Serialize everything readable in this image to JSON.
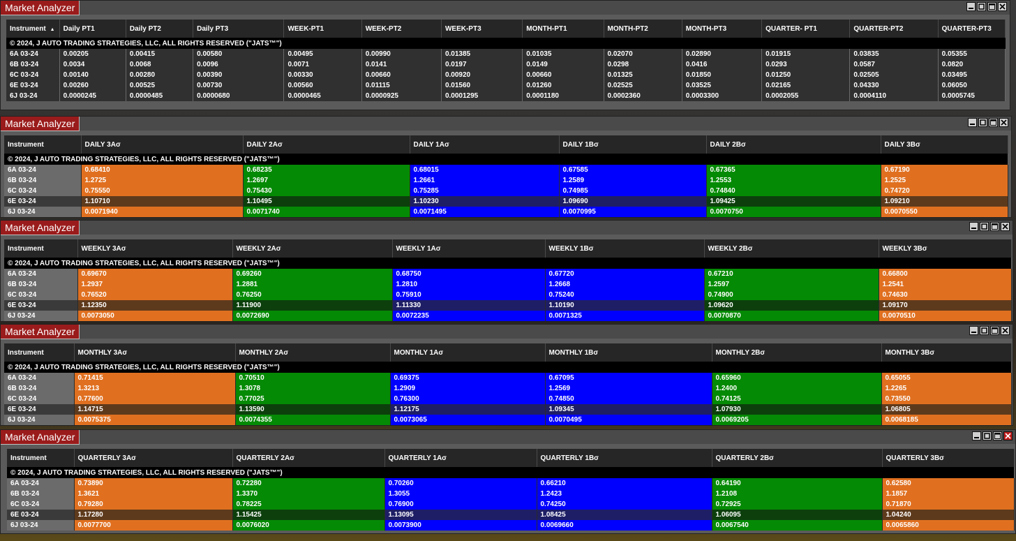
{
  "window_title": "Market Analyzer",
  "copyright": "© 2024, J AUTO TRADING STRATEGIES, LLC, ALL RIGHTS RESERVED (\"JATS™\")",
  "instrument_header": "Instrument",
  "sort_indicator": "▲",
  "colors": {
    "orange": "#e07020",
    "green": "#058a05",
    "blue": "#0000ff",
    "title_red": "#9a1b1b"
  },
  "icons": [
    "minimize-icon",
    "restore-icon",
    "maximize-icon",
    "close-icon"
  ],
  "instruments": [
    "6A 03-24",
    "6B 03-24",
    "6C 03-24",
    "6E 03-24",
    "6J 03-24"
  ],
  "targets": {
    "headers": [
      "Daily PT1",
      "Daily PT2",
      "Daily PT3",
      "WEEK-PT1",
      "WEEK-PT2",
      "WEEK-PT3",
      "MONTH-PT1",
      "MONTH-PT2",
      "MONTH-PT3",
      "QUARTER- PT1",
      "QUARTER-PT2",
      "QUARTER-PT3"
    ],
    "rows": [
      [
        "0.00205",
        "0.00415",
        "0.00580",
        "0.00495",
        "0.00990",
        "0.01385",
        "0.01035",
        "0.02070",
        "0.02890",
        "0.01915",
        "0.03835",
        "0.05355"
      ],
      [
        "0.0034",
        "0.0068",
        "0.0096",
        "0.0071",
        "0.0141",
        "0.0197",
        "0.0149",
        "0.0298",
        "0.0416",
        "0.0293",
        "0.0587",
        "0.0820"
      ],
      [
        "0.00140",
        "0.00280",
        "0.00390",
        "0.00330",
        "0.00660",
        "0.00920",
        "0.00660",
        "0.01325",
        "0.01850",
        "0.01250",
        "0.02505",
        "0.03495"
      ],
      [
        "0.00260",
        "0.00525",
        "0.00730",
        "0.00560",
        "0.01115",
        "0.01560",
        "0.01260",
        "0.02525",
        "0.03525",
        "0.02165",
        "0.04330",
        "0.06050"
      ],
      [
        "0.0000245",
        "0.0000485",
        "0.0000680",
        "0.0000465",
        "0.0000925",
        "0.0001295",
        "0.0001180",
        "0.0002360",
        "0.0003300",
        "0.0002055",
        "0.0004110",
        "0.0005745"
      ]
    ]
  },
  "daily": {
    "headers": [
      "DAILY 3Aσ",
      "DAILY 2Aσ",
      "DAILY 1Aσ",
      "DAILY 1Bσ",
      "DAILY 2Bσ",
      "DAILY 3Bσ"
    ],
    "rows": [
      [
        "0.68410",
        "0.68235",
        "0.68015",
        "0.67585",
        "0.67365",
        "0.67190"
      ],
      [
        "1.2725",
        "1.2697",
        "1.2661",
        "1.2589",
        "1.2553",
        "1.2525"
      ],
      [
        "0.75550",
        "0.75430",
        "0.75285",
        "0.74985",
        "0.74840",
        "0.74720"
      ],
      [
        "1.10710",
        "1.10495",
        "1.10230",
        "1.09690",
        "1.09425",
        "1.09210"
      ],
      [
        "0.0071940",
        "0.0071740",
        "0.0071495",
        "0.0070995",
        "0.0070750",
        "0.0070550"
      ]
    ]
  },
  "weekly": {
    "headers": [
      "WEEKLY 3Aσ",
      "WEEKLY 2Aσ",
      "WEEKLY 1Aσ",
      "WEEKLY 1Bσ",
      "WEEKLY 2Bσ",
      "WEEKLY 3Bσ"
    ],
    "rows": [
      [
        "0.69670",
        "0.69260",
        "0.68750",
        "0.67720",
        "0.67210",
        "0.66800"
      ],
      [
        "1.2937",
        "1.2881",
        "1.2810",
        "1.2668",
        "1.2597",
        "1.2541"
      ],
      [
        "0.76520",
        "0.76250",
        "0.75910",
        "0.75240",
        "0.74900",
        "0.74630"
      ],
      [
        "1.12350",
        "1.11900",
        "1.11330",
        "1.10190",
        "1.09620",
        "1.09170"
      ],
      [
        "0.0073050",
        "0.0072690",
        "0.0072235",
        "0.0071325",
        "0.0070870",
        "0.0070510"
      ]
    ]
  },
  "monthly": {
    "headers": [
      "MONTHLY 3Aσ",
      "MONTHLY 2Aσ",
      "MONTHLY 1Aσ",
      "MONTHLY 1Bσ",
      "MONTHLY 2Bσ",
      "MONTHLY 3Bσ"
    ],
    "rows": [
      [
        "0.71415",
        "0.70510",
        "0.69375",
        "0.67095",
        "0.65960",
        "0.65055"
      ],
      [
        "1.3213",
        "1.3078",
        "1.2909",
        "1.2569",
        "1.2400",
        "1.2265"
      ],
      [
        "0.77600",
        "0.77025",
        "0.76300",
        "0.74850",
        "0.74125",
        "0.73550"
      ],
      [
        "1.14715",
        "1.13590",
        "1.12175",
        "1.09345",
        "1.07930",
        "1.06805"
      ],
      [
        "0.0075375",
        "0.0074355",
        "0.0073065",
        "0.0070495",
        "0.0069205",
        "0.0068185"
      ]
    ]
  },
  "quarterly": {
    "headers": [
      "QUARTERLY 3Aσ",
      "QUARTERLY 2Aσ",
      "QUARTERLY 1Aσ",
      "QUARTERLY 1Bσ",
      "QUARTERLY 2Bσ",
      "QUARTERLY 3Bσ"
    ],
    "rows": [
      [
        "0.73890",
        "0.72280",
        "0.70260",
        "0.66210",
        "0.64190",
        "0.62580"
      ],
      [
        "1.3621",
        "1.3370",
        "1.3055",
        "1.2423",
        "1.2108",
        "1.1857"
      ],
      [
        "0.79280",
        "0.78225",
        "0.76900",
        "0.74250",
        "0.72925",
        "0.71870"
      ],
      [
        "1.17280",
        "1.15425",
        "1.13095",
        "1.08425",
        "1.06095",
        "1.04240"
      ],
      [
        "0.0077700",
        "0.0076020",
        "0.0073900",
        "0.0069660",
        "0.0067540",
        "0.0065860"
      ]
    ]
  }
}
